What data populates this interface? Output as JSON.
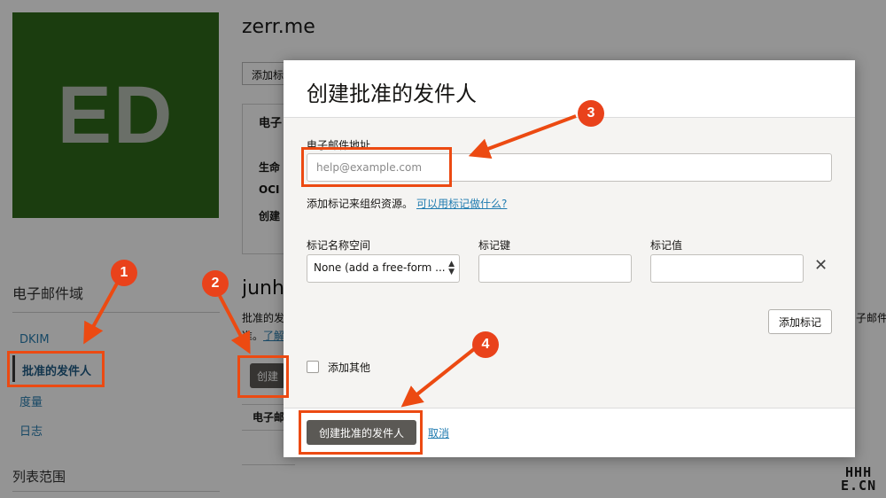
{
  "background": {
    "avatar_initials": "ED",
    "domain_title": "zerr.me",
    "add_tag_button": "添加标",
    "info_panel_heading": "电子",
    "info_rows": [
      "生命",
      "OCI",
      "创建"
    ],
    "section_title": "junh",
    "description_line1": "批准的发",
    "description_line2": "准。",
    "description_link": "了解",
    "right_text": "子邮件",
    "create_button": "创建",
    "table_header": "电子邮"
  },
  "sidebar": {
    "heading": "电子邮件域",
    "items": [
      {
        "label": "DKIM"
      },
      {
        "label": "批准的发件人"
      },
      {
        "label": "度量"
      },
      {
        "label": "日志"
      }
    ],
    "scope_heading": "列表范围"
  },
  "modal": {
    "title": "创建批准的发件人",
    "email_label": "电子邮件地址",
    "email_placeholder": "help@example.com",
    "email_value": "",
    "tag_hint": "添加标记来组织资源。",
    "tag_hint_link": "可以用标记做什么?",
    "namespace_label": "标记名称空间",
    "namespace_value": "None (add a free-form ...",
    "key_label": "标记键",
    "value_label": "标记值",
    "remove_icon": "✕",
    "add_tag_button": "添加标记",
    "add_more_label": "添加其他",
    "submit_button": "创建批准的发件人",
    "cancel_link": "取消"
  },
  "annotations": {
    "badges": [
      "1",
      "2",
      "3",
      "4"
    ],
    "accent_color": "#ec4a12"
  },
  "watermark": {
    "line1": "HHH",
    "line2": "E.CN"
  }
}
